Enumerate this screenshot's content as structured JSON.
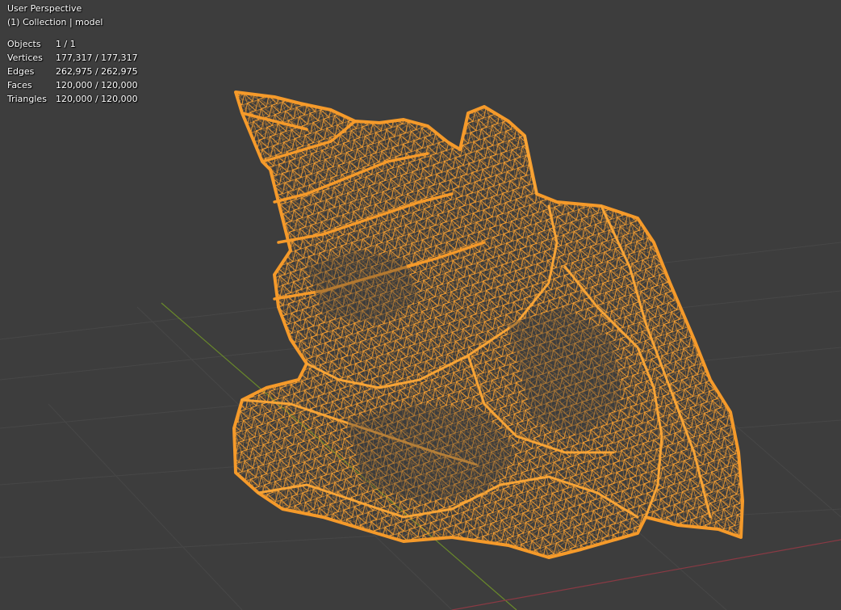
{
  "viewport": {
    "view_name": "User Perspective",
    "collection_label": "(1) Collection | model"
  },
  "statistics": [
    {
      "label": "Objects",
      "value": "1 / 1"
    },
    {
      "label": "Vertices",
      "value": "177,317 / 177,317"
    },
    {
      "label": "Edges",
      "value": "262,975 / 262,975"
    },
    {
      "label": "Faces",
      "value": "120,000 / 120,000"
    },
    {
      "label": "Triangles",
      "value": "120,000 / 120,000"
    }
  ],
  "colors": {
    "background": "#3d3d3d",
    "grid": "#4a4a4a",
    "x_axis": "#8a3a44",
    "y_axis": "#6a8a2a",
    "wireframe": "#f59a2a",
    "wireframe_dark": "#a8601a"
  },
  "model": {
    "name": "model",
    "display": "wireframe-selected"
  }
}
